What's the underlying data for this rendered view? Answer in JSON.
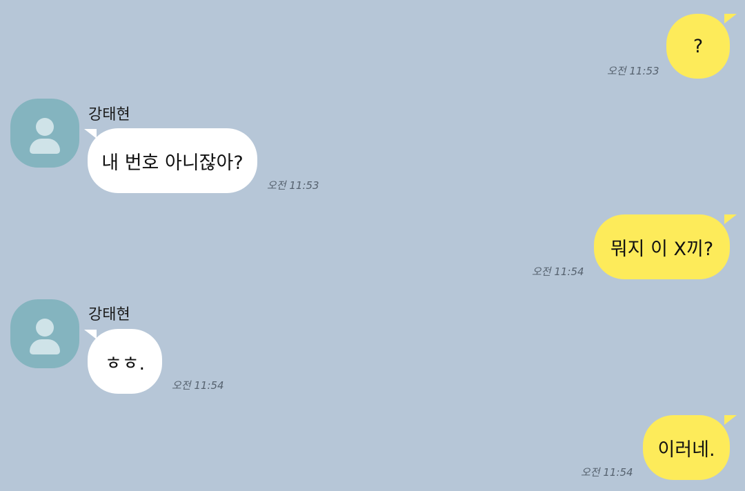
{
  "colors": {
    "background": "#b6c6d7",
    "outgoing_bubble": "#fdeb5a",
    "incoming_bubble": "#ffffff",
    "avatar": "#84b4bf"
  },
  "messages": [
    {
      "direction": "out",
      "text": "?",
      "time": "오전 11:53"
    },
    {
      "direction": "in",
      "sender": "강태현",
      "text": "내 번호 아니잖아?",
      "time": "오전 11:53"
    },
    {
      "direction": "out",
      "text": "뭐지 이 X끼?",
      "time": "오전 11:54"
    },
    {
      "direction": "in",
      "sender": "강태현",
      "text": "ㅎㅎ.",
      "time": "오전 11:54"
    },
    {
      "direction": "out",
      "text": "이러네.",
      "time": "오전 11:54"
    }
  ]
}
